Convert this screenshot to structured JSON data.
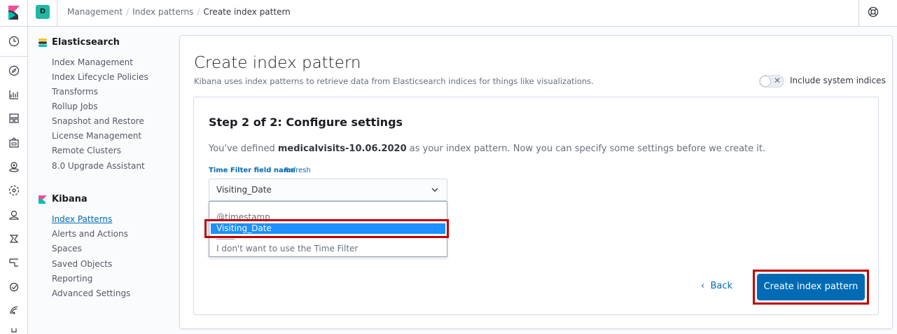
{
  "topbar": {
    "space_initial": "D",
    "breadcrumbs": [
      "Management",
      "Index patterns",
      "Create index pattern"
    ]
  },
  "sidenav": {
    "elasticsearch": {
      "title": "Elasticsearch",
      "items": [
        "Index Management",
        "Index Lifecycle Policies",
        "Transforms",
        "Rollup Jobs",
        "Snapshot and Restore",
        "License Management",
        "Remote Clusters",
        "8.0 Upgrade Assistant"
      ]
    },
    "kibana": {
      "title": "Kibana",
      "items": [
        "Index Patterns",
        "Alerts and Actions",
        "Spaces",
        "Saved Objects",
        "Reporting",
        "Advanced Settings"
      ],
      "active": "Index Patterns"
    }
  },
  "main": {
    "title": "Create index pattern",
    "description": "Kibana uses index patterns to retrieve data from Elasticsearch indices for things like visualizations.",
    "include_system_indices_label": "Include system indices",
    "include_system_indices": false,
    "step_title": "Step 2 of 2: Configure settings",
    "step_desc_prefix": "You've defined ",
    "index_pattern_name": "medicalvisits-10.06.2020",
    "step_desc_suffix": " as your index pattern. Now you can specify some settings before we create it.",
    "time_filter_label": "Time Filter field name",
    "refresh_label": "Refresh",
    "time_filter_value": "Visiting_Date",
    "dropdown_options": [
      "@timestamp",
      "Visiting_Date",
      "I don't want to use the Time Filter"
    ],
    "back_label": "Back",
    "create_label": "Create index pattern"
  },
  "colors": {
    "accent": "#006bb4",
    "highlight": "#c00000",
    "selected_option": "#1e90ff"
  }
}
